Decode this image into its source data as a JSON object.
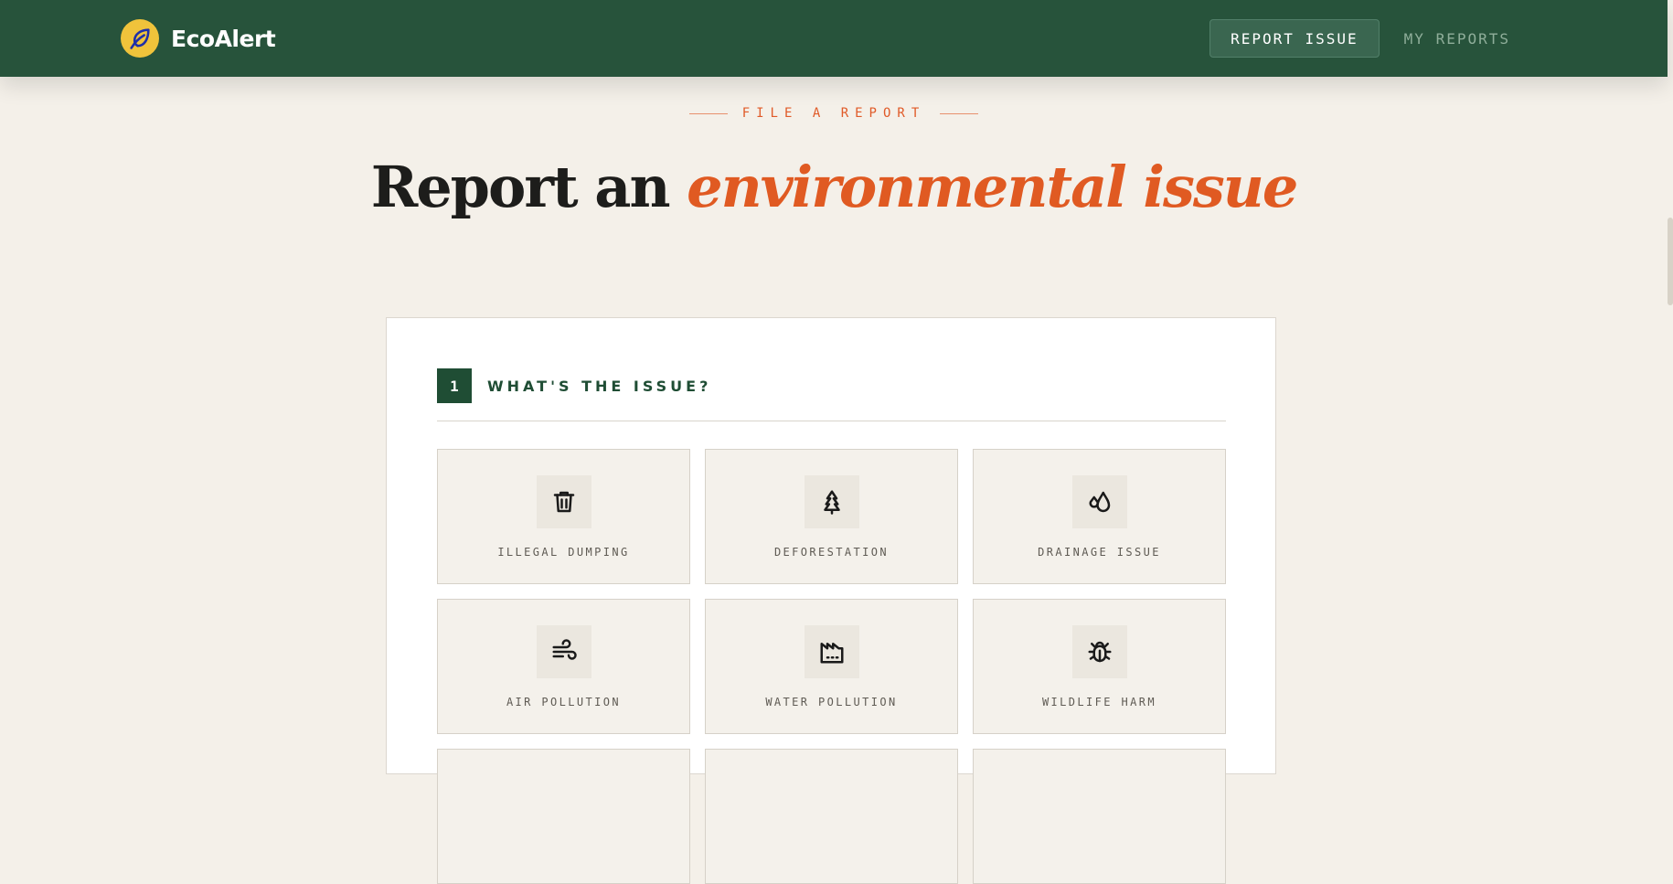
{
  "header": {
    "brand_name": "EcoAlert",
    "nav": [
      {
        "label": "REPORT ISSUE",
        "active": true
      },
      {
        "label": "MY REPORTS",
        "active": false
      }
    ]
  },
  "hero": {
    "eyebrow": "FILE A REPORT",
    "title_prefix": "Report an",
    "title_accent": "environmental issue"
  },
  "step": {
    "number": "1",
    "title": "WHAT'S THE ISSUE?"
  },
  "issue_types": [
    {
      "label": "ILLEGAL DUMPING",
      "icon": "trash-icon"
    },
    {
      "label": "DEFORESTATION",
      "icon": "tree-icon"
    },
    {
      "label": "DRAINAGE ISSUE",
      "icon": "droplets-icon"
    },
    {
      "label": "AIR POLLUTION",
      "icon": "wind-icon"
    },
    {
      "label": "WATER POLLUTION",
      "icon": "factory-icon"
    },
    {
      "label": "WILDLIFE HARM",
      "icon": "bug-icon"
    }
  ],
  "colors": {
    "header_bg": "#27533b",
    "page_bg": "#f4f0e9",
    "accent": "#e05a22",
    "logo": "#f0c33b",
    "step_badge": "#1f4d34"
  }
}
